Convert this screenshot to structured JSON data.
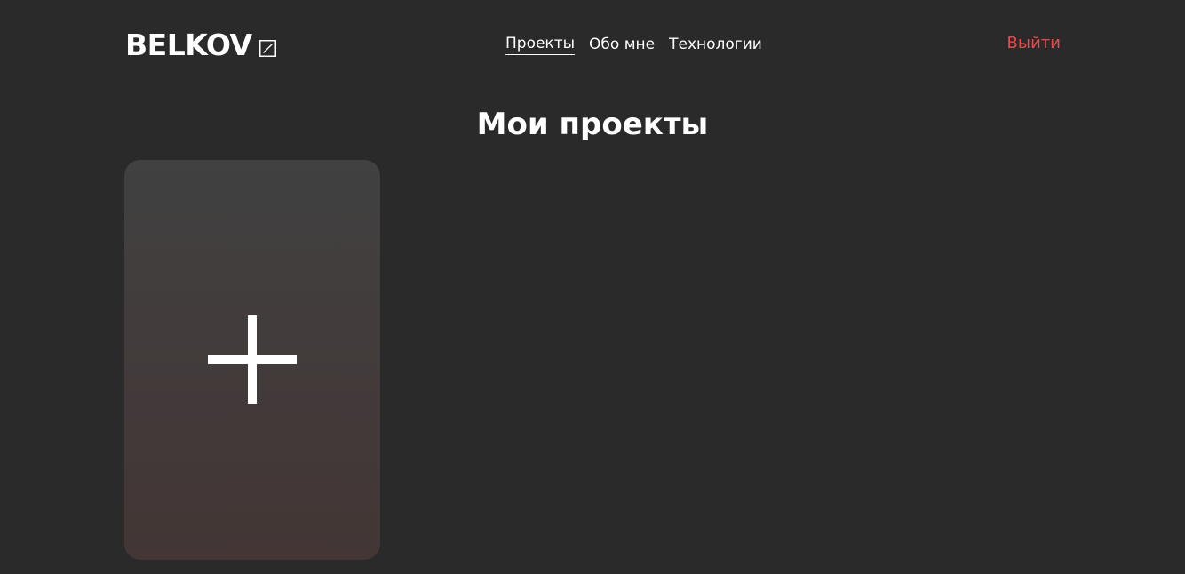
{
  "header": {
    "logo_text": "BELKOV",
    "logo_icon": "edit-square-icon",
    "nav": [
      {
        "label": "Проекты",
        "active": true
      },
      {
        "label": "Обо мне",
        "active": false
      },
      {
        "label": "Технологии",
        "active": false
      }
    ],
    "logout_label": "Выйти"
  },
  "main": {
    "title": "Мои проекты",
    "add_card_icon": "plus-icon"
  },
  "colors": {
    "background": "#2a2a2a",
    "text": "#ffffff",
    "logout": "#e84a4a",
    "card_top": "#414141",
    "card_bottom": "#433635"
  }
}
